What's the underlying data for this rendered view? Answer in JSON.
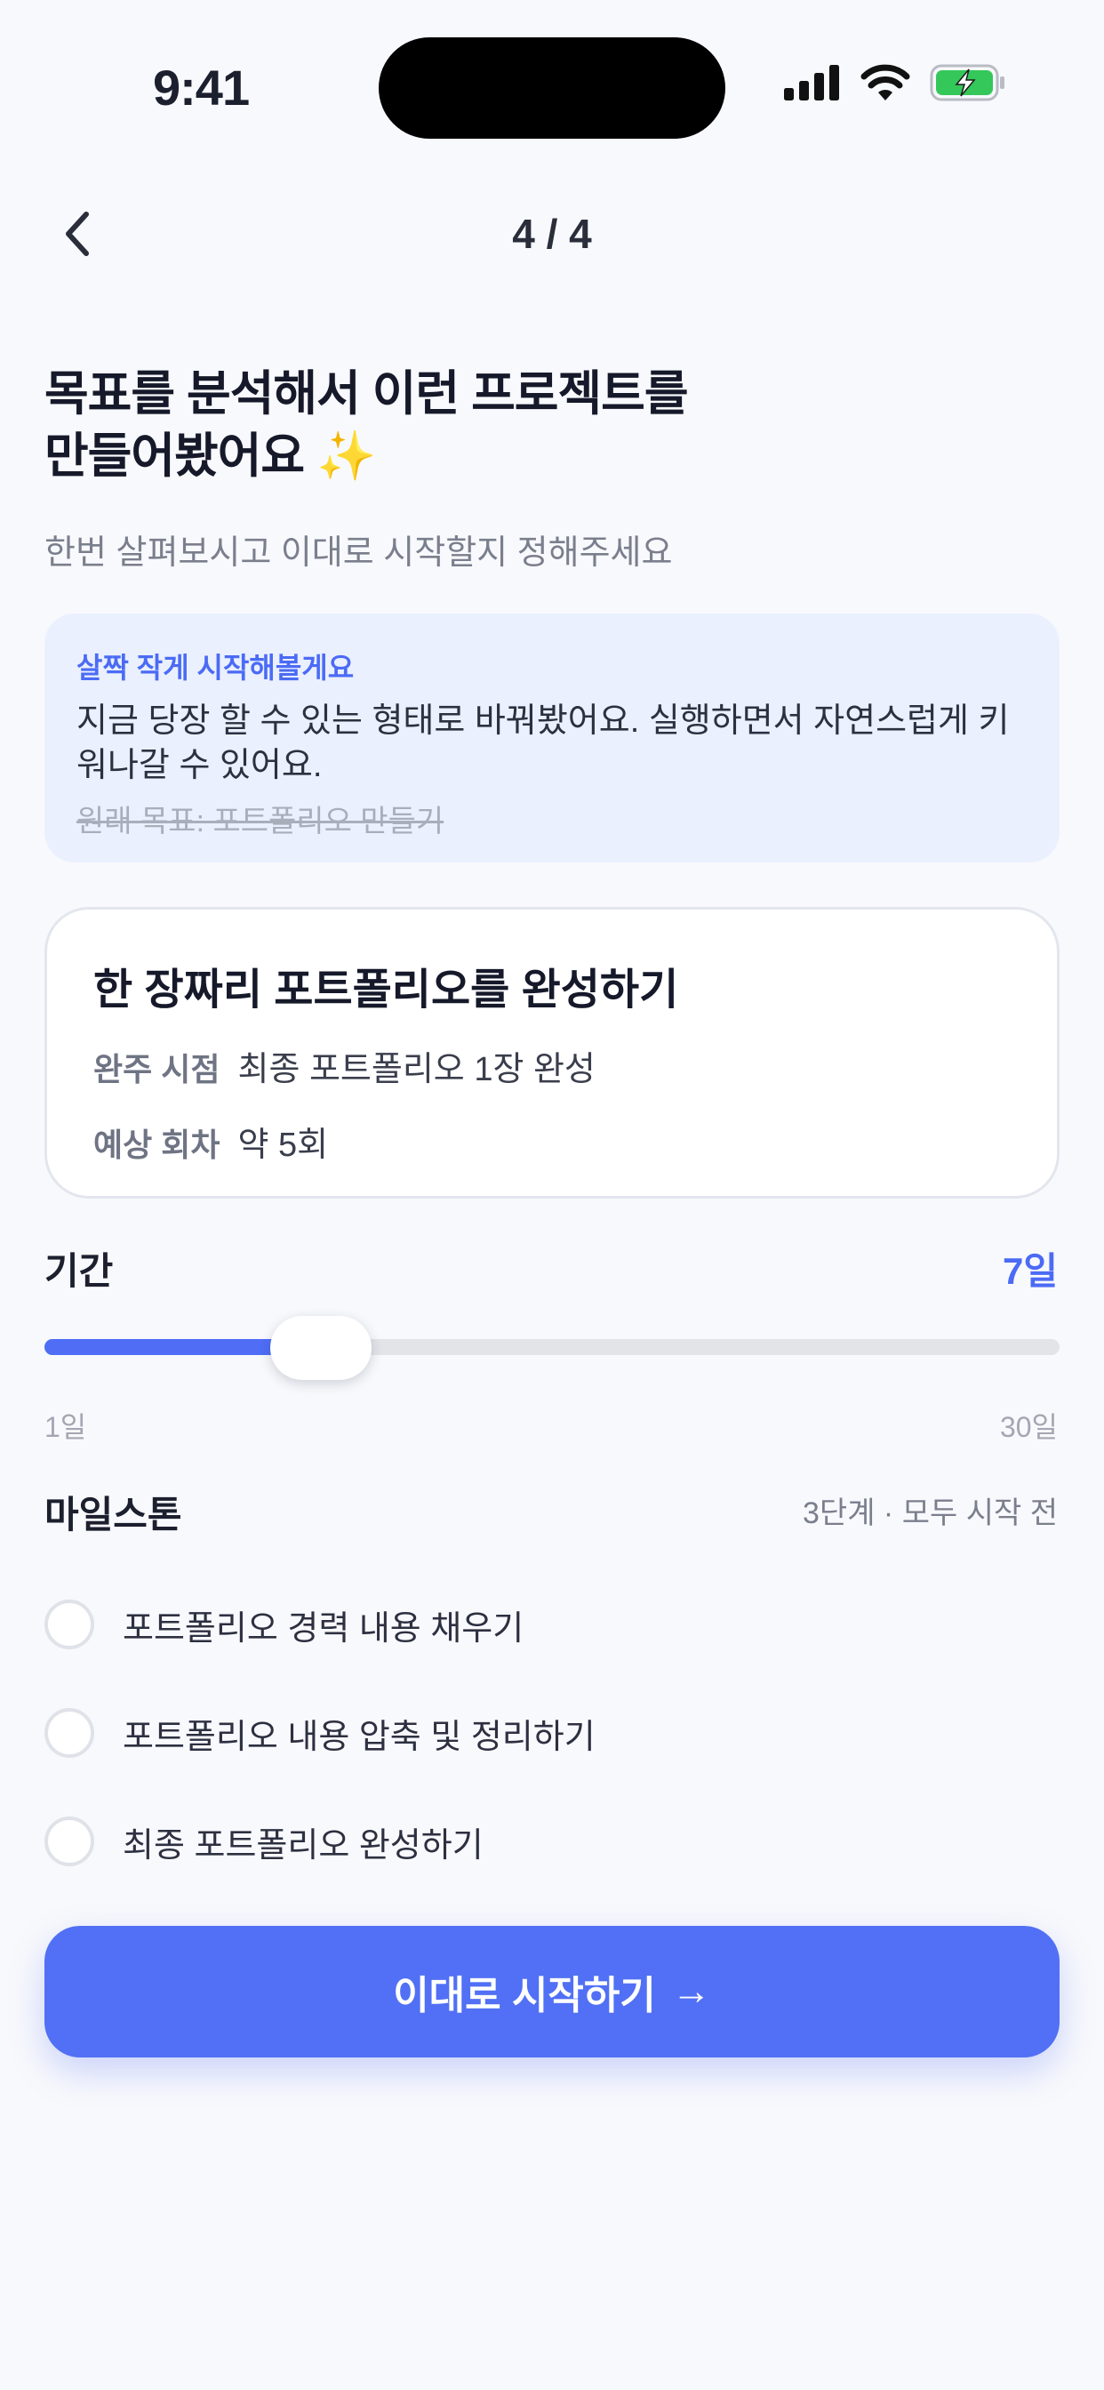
{
  "status_bar": {
    "time": "9:41"
  },
  "nav": {
    "step": "4 / 4"
  },
  "header": {
    "title_line1": "목표를 분석해서 이런 프로젝트를",
    "title_line2": "만들어봤어요 ✨",
    "subtitle": "한번 살펴보시고 이대로 시작할지 정해주세요"
  },
  "notice": {
    "heading": "살짝 작게 시작해볼게요",
    "body": "지금 당장 할 수 있는 형태로 바꿔봤어요. 실행하면서 자연스럽게 키워나갈 수 있어요.",
    "original_goal": "원래 목표: 포트폴리오 만들기"
  },
  "project": {
    "title": "한 장짜리 포트폴리오를 완성하기",
    "completion_label": "완주 시점",
    "completion_value": "최종 포트폴리오 1장 완성",
    "sessions_label": "예상 회차",
    "sessions_value": "약 5회"
  },
  "duration": {
    "label": "기간",
    "value_text": "7일",
    "value": 7,
    "min": 1,
    "max": 30,
    "min_label": "1일",
    "max_label": "30일"
  },
  "milestones": {
    "title": "마일스톤",
    "status": "3단계 · 모두 시작 전",
    "items": [
      {
        "label": "포트폴리오 경력 내용 채우기"
      },
      {
        "label": "포트폴리오 내용 압축 및 정리하기"
      },
      {
        "label": "최종 포트폴리오 완성하기"
      }
    ]
  },
  "cta": {
    "label": "이대로 시작하기",
    "arrow": "→"
  },
  "colors": {
    "accent": "#5170f5",
    "background": "#f8f9fc",
    "notice_bg": "#eaf0fe"
  }
}
